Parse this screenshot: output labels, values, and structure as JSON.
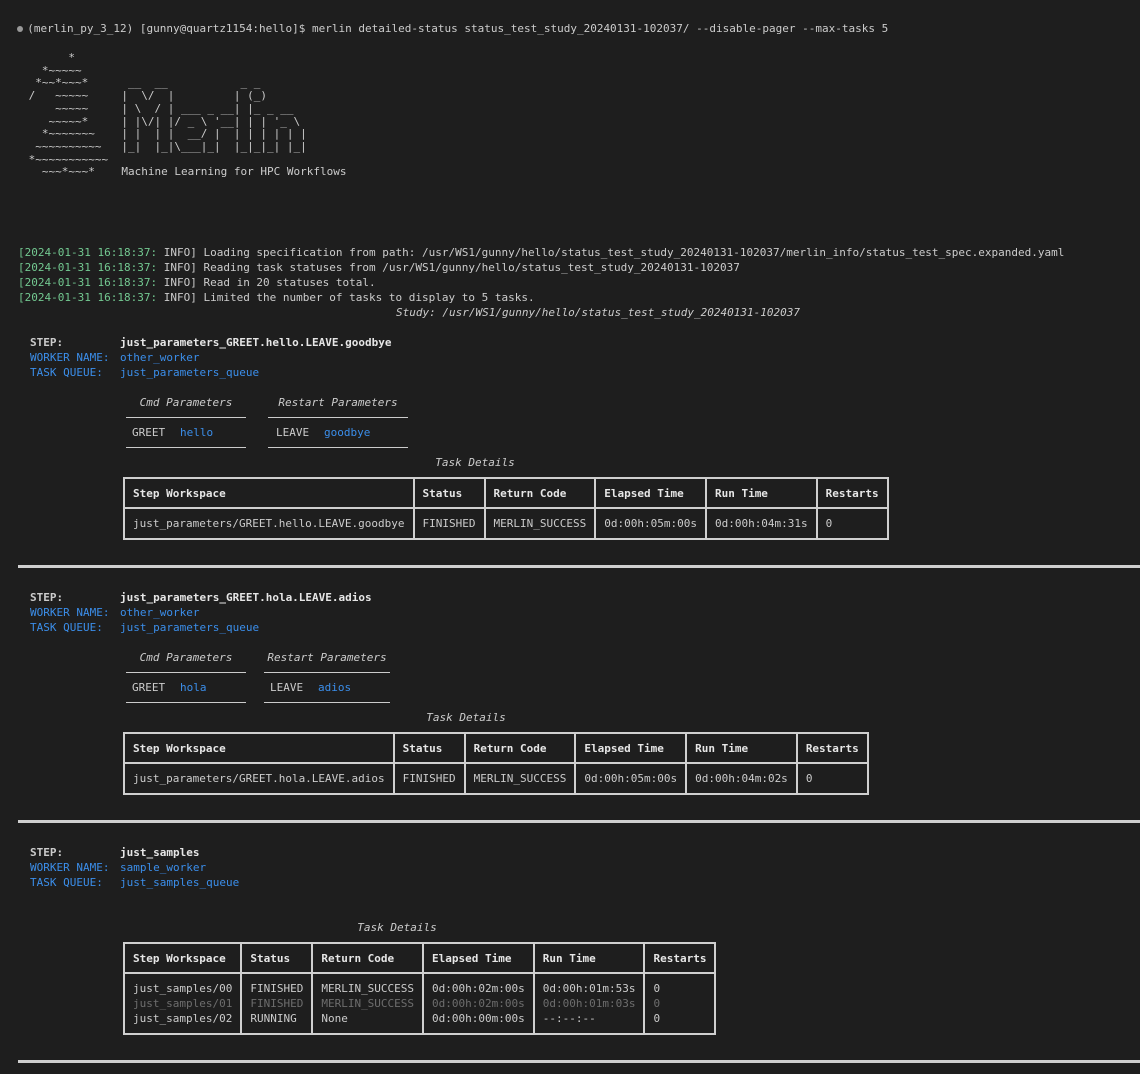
{
  "command": {
    "env": "(merlin_py_3_12)",
    "prompt": "[gunny@quartz1154:hello]$",
    "text": "merlin detailed-status status_test_study_20240131-102037/ --disable-pager --max-tasks 5"
  },
  "banner": "       *\n   *~~~~~\n  *~~*~~~*      __  __           _ _\n /   ~~~~~     |  \\/  |         | (_)\n     ~~~~~     | \\  / | ___ _ __| |_ _ __\n    ~~~~~*     | |\\/| |/ _ \\ '__| | | '_ \\\n   *~~~~~~~    | |  | |  __/ |  | | | | | |\n  ~~~~~~~~~~   |_|  |_|\\___|_|  |_|_|_| |_|\n *~~~~~~~~~~~\n   ~~~*~~~*    Machine Learning for HPC Workflows",
  "logs": [
    {
      "ts": "[2024-01-31 16:18:37:",
      "level": "INFO]",
      "msg": "Loading specification from path: /usr/WS1/gunny/hello/status_test_study_20240131-102037/merlin_info/status_test_spec.expanded.yaml"
    },
    {
      "ts": "[2024-01-31 16:18:37:",
      "level": "INFO]",
      "msg": "Reading task statuses from /usr/WS1/gunny/hello/status_test_study_20240131-102037"
    },
    {
      "ts": "[2024-01-31 16:18:37:",
      "level": "INFO]",
      "msg": "Read in 20 statuses total."
    },
    {
      "ts": "[2024-01-31 16:18:37:",
      "level": "INFO]",
      "msg": "Limited the number of tasks to display to 5 tasks."
    }
  ],
  "study_line": "Study: /usr/WS1/gunny/hello/status_test_study_20240131-102037",
  "labels": {
    "step": "STEP:",
    "worker": "WORKER NAME:",
    "queue": "TASK QUEUE:",
    "cmd_params": "Cmd Parameters",
    "restart_params": "Restart Parameters",
    "task_details": "Task Details"
  },
  "columns": [
    "Step Workspace",
    "Status",
    "Return Code",
    "Elapsed Time",
    "Run Time",
    "Restarts"
  ],
  "steps": [
    {
      "step": "just_parameters_GREET.hello.LEAVE.goodbye",
      "worker": "other_worker",
      "queue": "just_parameters_queue",
      "cmd_key": "GREET",
      "cmd_val": "hello",
      "restart_key": "LEAVE",
      "restart_val": "goodbye",
      "rows": [
        {
          "workspace": "just_parameters/GREET.hello.LEAVE.goodbye",
          "status": "FINISHED",
          "code": "MERLIN_SUCCESS",
          "elapsed": "0d:00h:05m:00s",
          "run": "0d:00h:04m:31s",
          "restarts": "0"
        }
      ]
    },
    {
      "step": "just_parameters_GREET.hola.LEAVE.adios",
      "worker": "other_worker",
      "queue": "just_parameters_queue",
      "cmd_key": "GREET",
      "cmd_val": "hola",
      "restart_key": "LEAVE",
      "restart_val": "adios",
      "rows": [
        {
          "workspace": "just_parameters/GREET.hola.LEAVE.adios",
          "status": "FINISHED",
          "code": "MERLIN_SUCCESS",
          "elapsed": "0d:00h:05m:00s",
          "run": "0d:00h:04m:02s",
          "restarts": "0"
        }
      ]
    },
    {
      "step": "just_samples",
      "worker": "sample_worker",
      "queue": "just_samples_queue",
      "rows": [
        {
          "workspace": "just_samples/00",
          "status": "FINISHED",
          "code": "MERLIN_SUCCESS",
          "elapsed": "0d:00h:02m:00s",
          "run": "0d:00h:01m:53s",
          "restarts": "0"
        },
        {
          "workspace": "just_samples/01",
          "status": "FINISHED",
          "code": "MERLIN_SUCCESS",
          "elapsed": "0d:00h:02m:00s",
          "run": "0d:00h:01m:03s",
          "restarts": "0"
        },
        {
          "workspace": "just_samples/02",
          "status": "RUNNING",
          "code": "None",
          "elapsed": "0d:00h:00m:00s",
          "run": "--:--:--",
          "restarts": "0"
        }
      ]
    }
  ],
  "colors": {
    "background": "#1e1e1e",
    "timestamp": "#73c991",
    "accent_blue": "#3b8eea",
    "finished": "#23d18b",
    "border": "#cfcfcf"
  }
}
